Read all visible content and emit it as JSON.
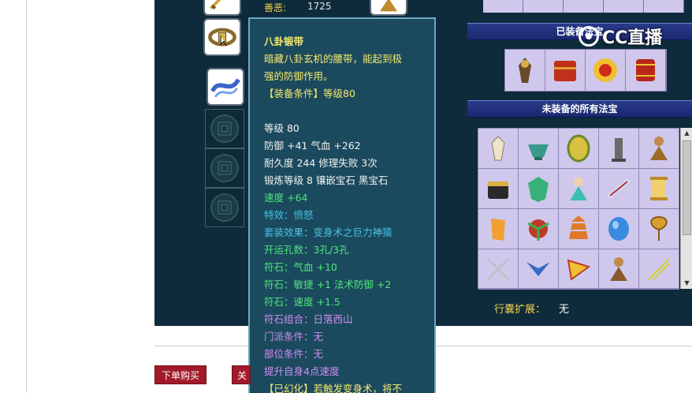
{
  "stats": {
    "label": "善恶:",
    "value": "1725"
  },
  "tooltip": {
    "title": "八卦锻带",
    "desc_line1": "暗藏八卦玄机的腰带，能起到极",
    "desc_line2": "强的防御作用。",
    "requirement": "【装备条件】等级80",
    "level": "等级 80",
    "defense": "防御 +41 气血 +262",
    "durability": "耐久度 244 修理失败 3次",
    "forge": "锻炼等级 8 镶嵌宝石 黑宝石",
    "speed": "速度 +64",
    "effect": "特效：愤怒",
    "set_effect": "套装效果：变身术之巨力神猿",
    "holes": "开运孔数：3孔/3孔",
    "rune1": "符石：气血 +10",
    "rune2": "符石：敏捷 +1 法术防御 +2",
    "rune3": "符石：速度 +1.5",
    "rune_combo": "符石组合：日落西山",
    "sect_req": "门派条件：无",
    "part_req": "部位条件：无",
    "bonus": "提升自身4点速度",
    "illusion": "【已幻化】若触发变身术，将不"
  },
  "right_panel": {
    "equipped_title": "已装备法宝",
    "unequipped_title": "未装备的所有法宝",
    "bag_label": "行囊扩展：",
    "bag_value": "无"
  },
  "buttons": {
    "order": "下单购买",
    "follow": "关注"
  },
  "watermark": {
    "text": "CC直播"
  },
  "colors": {
    "panel": "#0e2b3b",
    "tooltip_bg": "#1b4a5e",
    "title_yellow": "#f6e86d",
    "stat_green": "#4fe57a",
    "set_teal": "#49c2e6",
    "rune_purple": "#d28cf2",
    "button_red": "#a11a2a"
  }
}
